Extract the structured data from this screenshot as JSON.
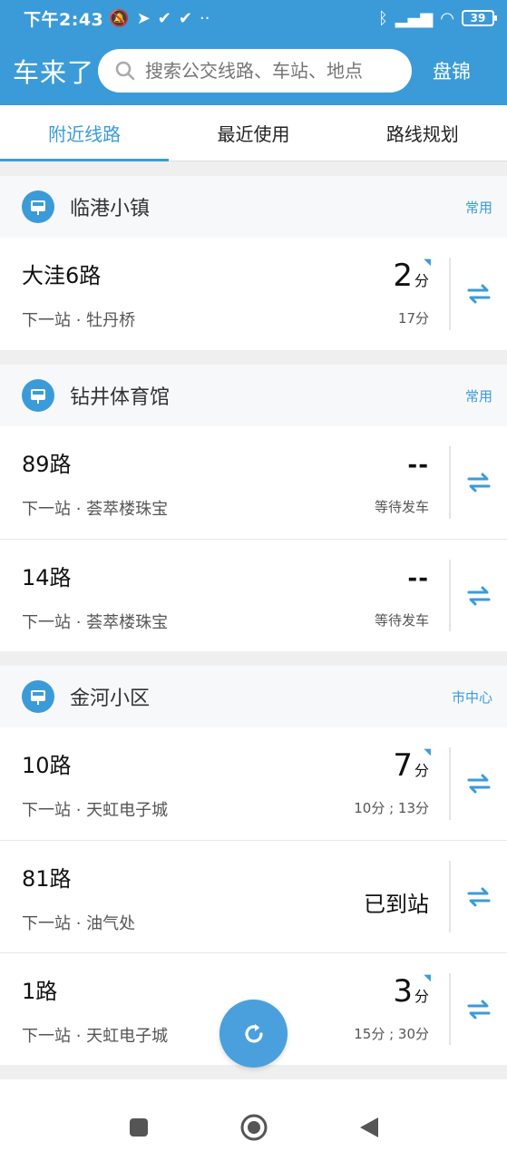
{
  "status_bar": {
    "time": "下午2:43",
    "battery": "39"
  },
  "header": {
    "app_title": "车来了",
    "search_placeholder": "搜索公交线路、车站、地点",
    "city": "盘锦"
  },
  "tabs": [
    "附近线路",
    "最近使用",
    "路线规划"
  ],
  "groups": [
    {
      "station": "临港小镇",
      "tag": "常用",
      "lines": [
        {
          "name": "大洼6路",
          "next": "下一站 · 牡丹桥",
          "eta_value": "2",
          "eta_unit": "分",
          "eta_sub": "17分"
        }
      ]
    },
    {
      "station": "钻井体育馆",
      "tag": "常用",
      "lines": [
        {
          "name": "89路",
          "next": "下一站 · 荟萃楼珠宝",
          "eta_dash": "--",
          "eta_sub": "等待发车"
        },
        {
          "name": "14路",
          "next": "下一站 · 荟萃楼珠宝",
          "eta_dash": "--",
          "eta_sub": "等待发车"
        }
      ]
    },
    {
      "station": "金河小区",
      "tag": "市中心",
      "lines": [
        {
          "name": "10路",
          "next": "下一站 · 天虹电子城",
          "eta_value": "7",
          "eta_unit": "分",
          "eta_sub": "10分 ; 13分"
        },
        {
          "name": "81路",
          "next": "下一站 · 油气处",
          "eta_arrived": "已到站"
        },
        {
          "name": "1路",
          "next": "下一站 · 天虹电子城",
          "eta_value": "3",
          "eta_unit": "分",
          "eta_sub": "15分 ; 30分"
        }
      ]
    }
  ],
  "colors": {
    "primary": "#3b9bd9",
    "background": "#efefef"
  },
  "icons": {
    "station": "bus-stop-icon",
    "swap": "swap-direction-icon",
    "signal": "realtime-signal-icon",
    "refresh": "refresh-icon"
  }
}
